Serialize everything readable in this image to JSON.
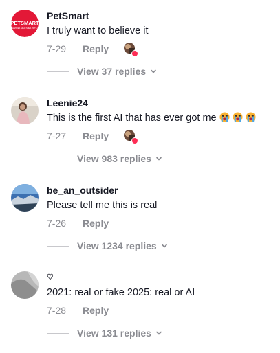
{
  "comments": [
    {
      "username": "PetSmart",
      "text": "I truly want to believe it",
      "date": "7-29",
      "reply_label": "Reply",
      "view_replies": "View 37 replies",
      "avatar": {
        "text_top": "PETSMART",
        "text_bottom": "HAPPIER. HEALTHIER. PETS.",
        "bg": "#e31837"
      }
    },
    {
      "username": "Leenie24",
      "text": "This is the first AI that has ever got me",
      "date": "7-27",
      "reply_label": "Reply",
      "view_replies": "View 983 replies"
    },
    {
      "username": "be_an_outsider",
      "text": "Please tell me this is real",
      "date": "7-26",
      "reply_label": "Reply",
      "view_replies": "View 1234 replies"
    },
    {
      "username": "♡",
      "text": "2021: real or fake 2025: real or AI",
      "date": "7-28",
      "reply_label": "Reply",
      "view_replies": "View 131 replies"
    }
  ],
  "colors": {
    "accent": "#fe2c55",
    "muted": "#8a8b91",
    "text": "#161823"
  }
}
